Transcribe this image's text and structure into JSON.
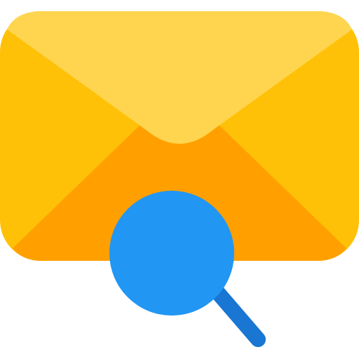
{
  "icon": {
    "name": "mail-search-icon",
    "parts": [
      "envelope-icon",
      "magnifier-icon"
    ]
  },
  "colors": {
    "envelope_body": "#FFC107",
    "envelope_flap": "#FFD54F",
    "envelope_inner": "#FFA000",
    "magnifier_lens": "#2196F3",
    "magnifier_handle": "#1976D2"
  }
}
